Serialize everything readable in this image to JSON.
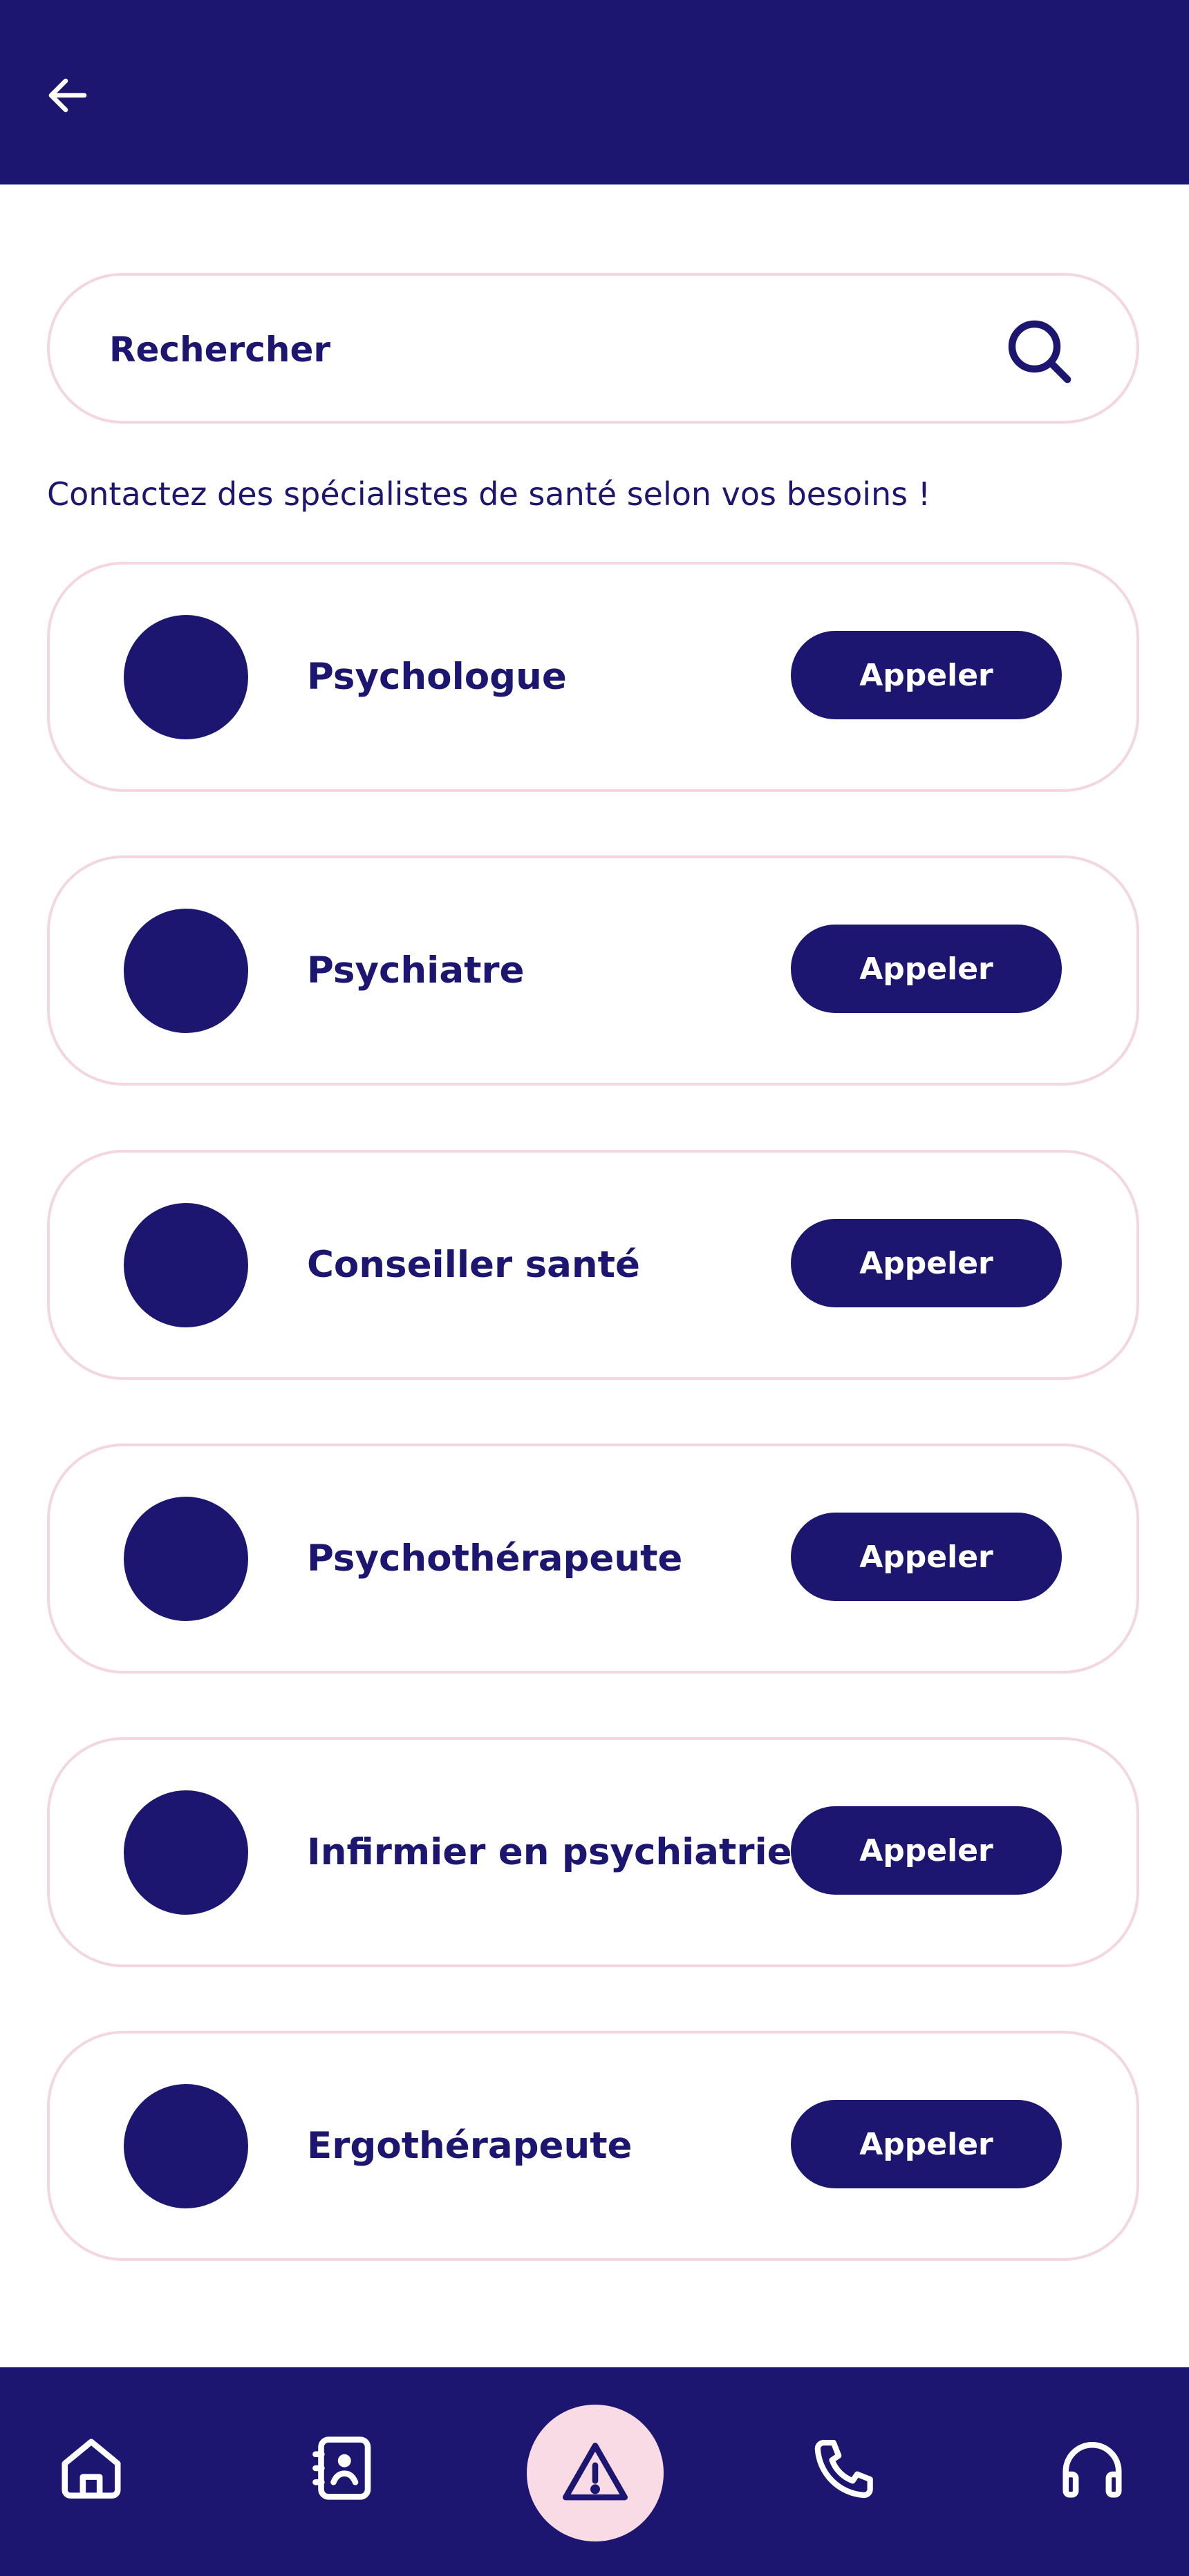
{
  "colors": {
    "primary": "#1c1670",
    "accent_soft": "#f8dbe4",
    "card_border": "#f4d6e0"
  },
  "header": {
    "back_icon": "arrow-left-icon"
  },
  "search": {
    "placeholder": "Rechercher",
    "value": "",
    "icon": "search-icon"
  },
  "intro_text": "Contactez des spécialistes de santé selon vos besoins !",
  "specialists": [
    {
      "title": "Psychologue",
      "button_label": "Appeler"
    },
    {
      "title": "Psychiatre",
      "button_label": "Appeler"
    },
    {
      "title": "Conseiller santé",
      "button_label": "Appeler"
    },
    {
      "title": "Psychothérapeute",
      "button_label": "Appeler"
    },
    {
      "title": "Infirmier en psychiatrie",
      "button_label": "Appeler"
    },
    {
      "title": "Ergothérapeute",
      "button_label": "Appeler"
    }
  ],
  "bottom_nav": [
    {
      "icon": "home-icon"
    },
    {
      "icon": "contact-card-icon"
    },
    {
      "icon": "warning-icon",
      "active": true
    },
    {
      "icon": "phone-icon"
    },
    {
      "icon": "headphones-icon"
    }
  ]
}
